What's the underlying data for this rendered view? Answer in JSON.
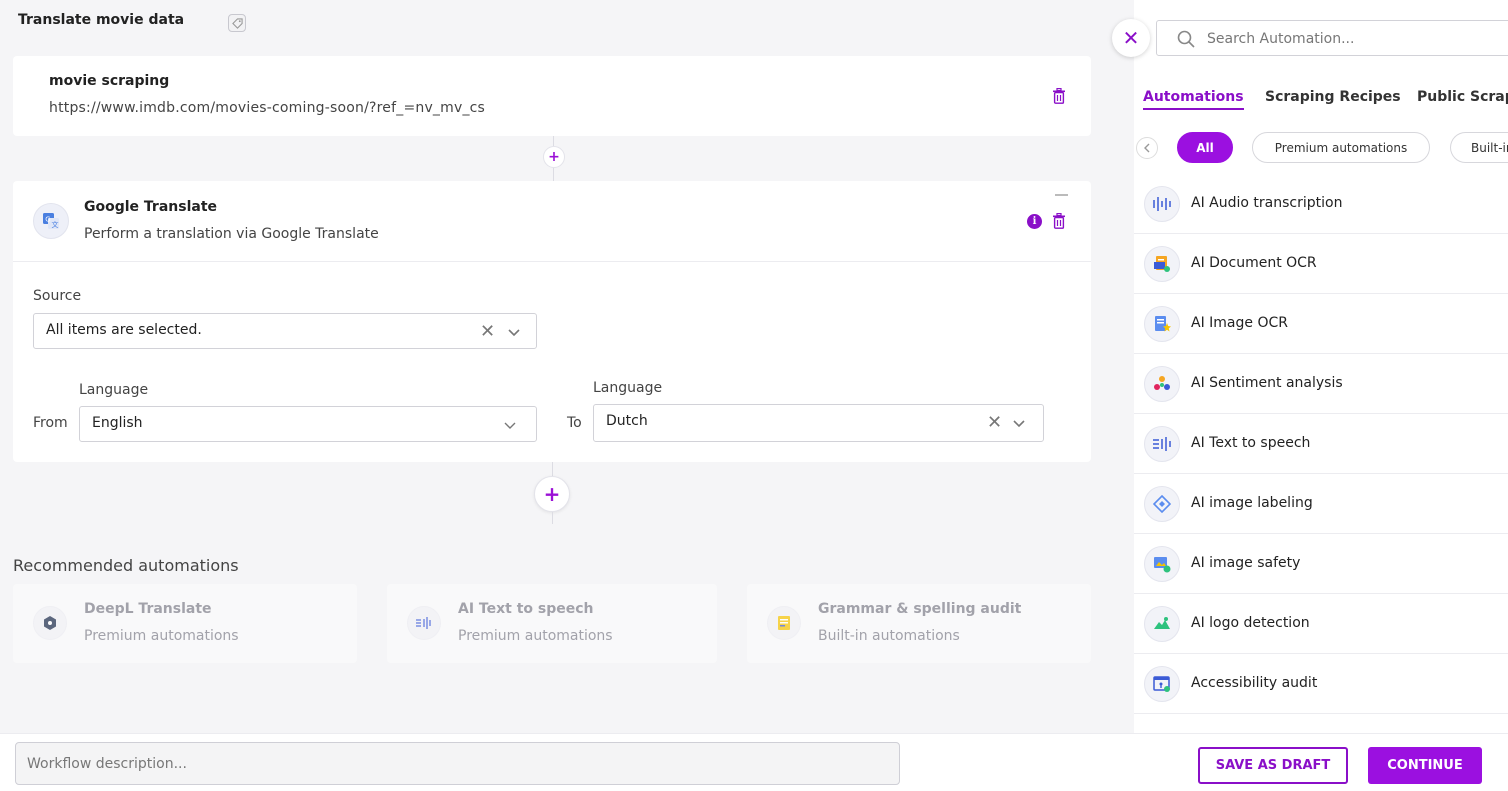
{
  "workflow": {
    "title": "Translate movie data"
  },
  "step1": {
    "name": "movie scraping",
    "url": "https://www.imdb.com/movies-coming-soon/?ref_=nv_mv_cs"
  },
  "step2": {
    "name": "Google Translate",
    "description": "Perform a translation via Google Translate",
    "source_label": "Source",
    "source_value": "All items are selected.",
    "from_label": "From",
    "to_label": "To",
    "language_label": "Language",
    "from_value": "English",
    "to_value": "Dutch",
    "info_glyph": "i",
    "clear_glyph": "✕"
  },
  "recommended": {
    "title": "Recommended automations",
    "items": [
      {
        "name": "DeepL Translate",
        "category": "Premium automations"
      },
      {
        "name": "AI Text to speech",
        "category": "Premium automations"
      },
      {
        "name": "Grammar & spelling audit",
        "category": "Built-in automations"
      }
    ]
  },
  "footer": {
    "description_placeholder": "Workflow description...",
    "save_draft_label": "SAVE AS DRAFT",
    "continue_label": "CONTINUE"
  },
  "panel": {
    "close_glyph": "✕",
    "search_placeholder": "Search Automation...",
    "tabs": [
      "Automations",
      "Scraping Recipes",
      "Public Scraping"
    ],
    "active_tab": "Automations",
    "chips": [
      "All",
      "Premium automations",
      "Built-in automations"
    ],
    "active_chip": "All",
    "items": [
      {
        "name": "AI Audio transcription",
        "icon": "audio-wave-icon"
      },
      {
        "name": "AI Document OCR",
        "icon": "document-ocr-icon"
      },
      {
        "name": "AI Image OCR",
        "icon": "image-ocr-icon"
      },
      {
        "name": "AI Sentiment analysis",
        "icon": "sentiment-icon"
      },
      {
        "name": "AI Text to speech",
        "icon": "text-to-speech-icon"
      },
      {
        "name": "AI image labeling",
        "icon": "image-labeling-icon"
      },
      {
        "name": "AI image safety",
        "icon": "image-safety-icon"
      },
      {
        "name": "AI logo detection",
        "icon": "logo-detection-icon"
      },
      {
        "name": "Accessibility audit",
        "icon": "accessibility-icon"
      }
    ]
  },
  "colors": {
    "accent": "#8a0fc8",
    "accent_bright": "#9b10e0",
    "background": "#f5f5f7"
  }
}
